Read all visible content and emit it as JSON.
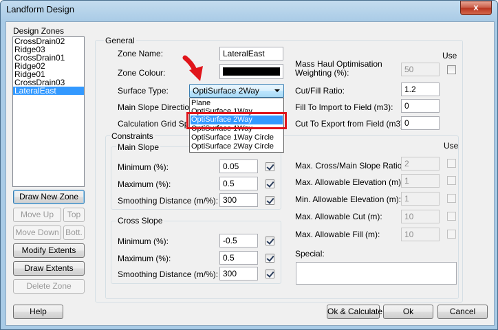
{
  "window": {
    "title": "Landform Design",
    "close_glyph": "x"
  },
  "zones": {
    "heading": "Design Zones",
    "items": [
      "CrossDrain02",
      "Ridge03",
      "CrossDrain01",
      "Ridge02",
      "Ridge01",
      "CrossDrain03",
      "LateralEast"
    ],
    "selected": "LateralEast"
  },
  "zone_buttons": {
    "draw_new": "Draw New Zone",
    "move_up": "Move Up",
    "top": "Top",
    "move_down": "Move Down",
    "bottom": "Bott.",
    "modify": "Modify Extents",
    "draw_extents": "Draw Extents",
    "delete": "Delete Zone"
  },
  "general": {
    "title": "General",
    "zone_name_label": "Zone Name:",
    "zone_name": "LateralEast",
    "zone_colour_label": "Zone Colour:",
    "zone_colour": "#000000",
    "surface_type_label": "Surface Type:",
    "surface_type": "OptiSurface 2Way",
    "main_slope_dir_label": "Main Slope Direction (",
    "calc_grid_label": "Calculation Grid Spac",
    "dropdown_options": [
      "Plane",
      "OptiSurface 1Way",
      "OptiSurface 2Way",
      "OptiSurface 1Way",
      "OptiSurface 1Way Circle",
      "OptiSurface 2Way Circle"
    ],
    "highlighted_option": "OptiSurface 2Way",
    "use_label": "Use",
    "mass_haul_label_1": "Mass Haul Optimisation",
    "mass_haul_label_2": "Weighting (%):",
    "mass_haul_value": "50",
    "cut_fill_label": "Cut/Fill Ratio:",
    "cut_fill_value": "1.2",
    "fill_import_label": "Fill To Import to Field (m3):",
    "fill_import_value": "0",
    "cut_export_label": "Cut To Export from Field (m3):",
    "cut_export_value": "0"
  },
  "constraints": {
    "title": "Constraints",
    "use_label": "Use",
    "main_slope": {
      "title": "Main Slope",
      "minimum_label": "Minimum (%):",
      "minimum": "0.05",
      "maximum_label": "Maximum (%):",
      "maximum": "0.5",
      "smoothing_label": "Smoothing Distance (m/%):",
      "smoothing": "300"
    },
    "cross_slope": {
      "title": "Cross Slope",
      "minimum_label": "Minimum (%):",
      "minimum": "-0.5",
      "maximum_label": "Maximum (%):",
      "maximum": "0.5",
      "smoothing_label": "Smoothing Distance (m/%):",
      "smoothing": "300"
    },
    "right": {
      "max_cross_main_label": "Max. Cross/Main Slope Ratio:",
      "max_cross_main": "2",
      "max_elev_label": "Max. Allowable Elevation (m):",
      "max_elev": "1",
      "min_elev_label": "Min. Allowable Elevation (m):",
      "min_elev": "1",
      "max_cut_label": "Max. Allowable Cut (m):",
      "max_cut": "10",
      "max_fill_label": "Max. Allowable Fill (m):",
      "max_fill": "10",
      "special_label": "Special:",
      "special": ""
    }
  },
  "footer": {
    "help": "Help",
    "ok_calculate": "Ok & Calculate",
    "ok": "Ok",
    "cancel": "Cancel"
  },
  "colors": {
    "annotation_arrow": "#e0151b",
    "selection": "#3399ff"
  }
}
